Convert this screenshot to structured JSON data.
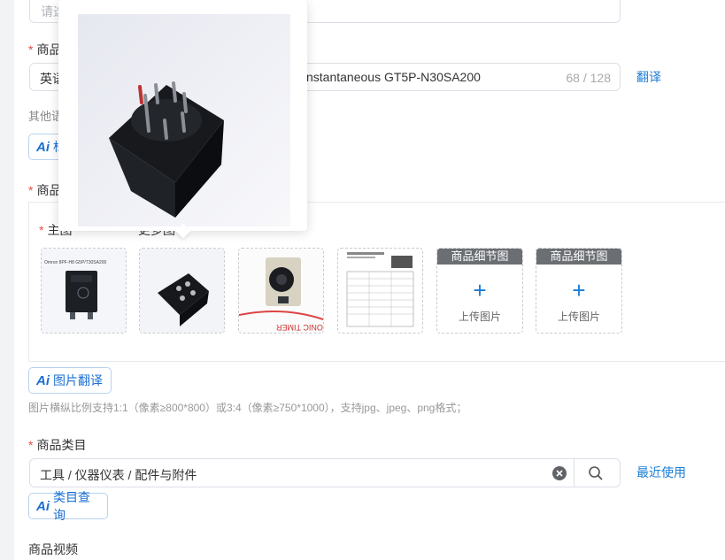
{
  "top_input": {
    "placeholder": "请选"
  },
  "title_field": {
    "label": "商品",
    "lang": "英语",
    "value": "nstantaneous GT5P-N30SA200",
    "count": "68 / 128",
    "translate_link": "翻译"
  },
  "other_label": "其他语",
  "ai_title_btn": {
    "label": "标"
  },
  "images_section": {
    "label": "商品",
    "main_label": "主图",
    "more_label": "更多图",
    "thumb1_caption": "Omron 8PF-H8 G5P/T30SA200",
    "thumb3_caption": "ONIC TIMER",
    "upload_header": "商品细节图",
    "upload_text": "上传图片",
    "ai_image_translate": "图片翻译",
    "hint": "图片横纵比例支持1:1（像素≥800*800）或3:4（像素≥750*1000），支持jpg、jpeg、png格式；"
  },
  "category": {
    "label": "商品类目",
    "value": "工具 / 仪器仪表 / 配件与附件",
    "recent_link": "最近使用",
    "ai_query": "类目查询"
  },
  "video": {
    "label": "商品视频"
  },
  "ai_badge": "Ai",
  "colors": {
    "accent": "#1a7dd6",
    "required": "#e54d42"
  }
}
